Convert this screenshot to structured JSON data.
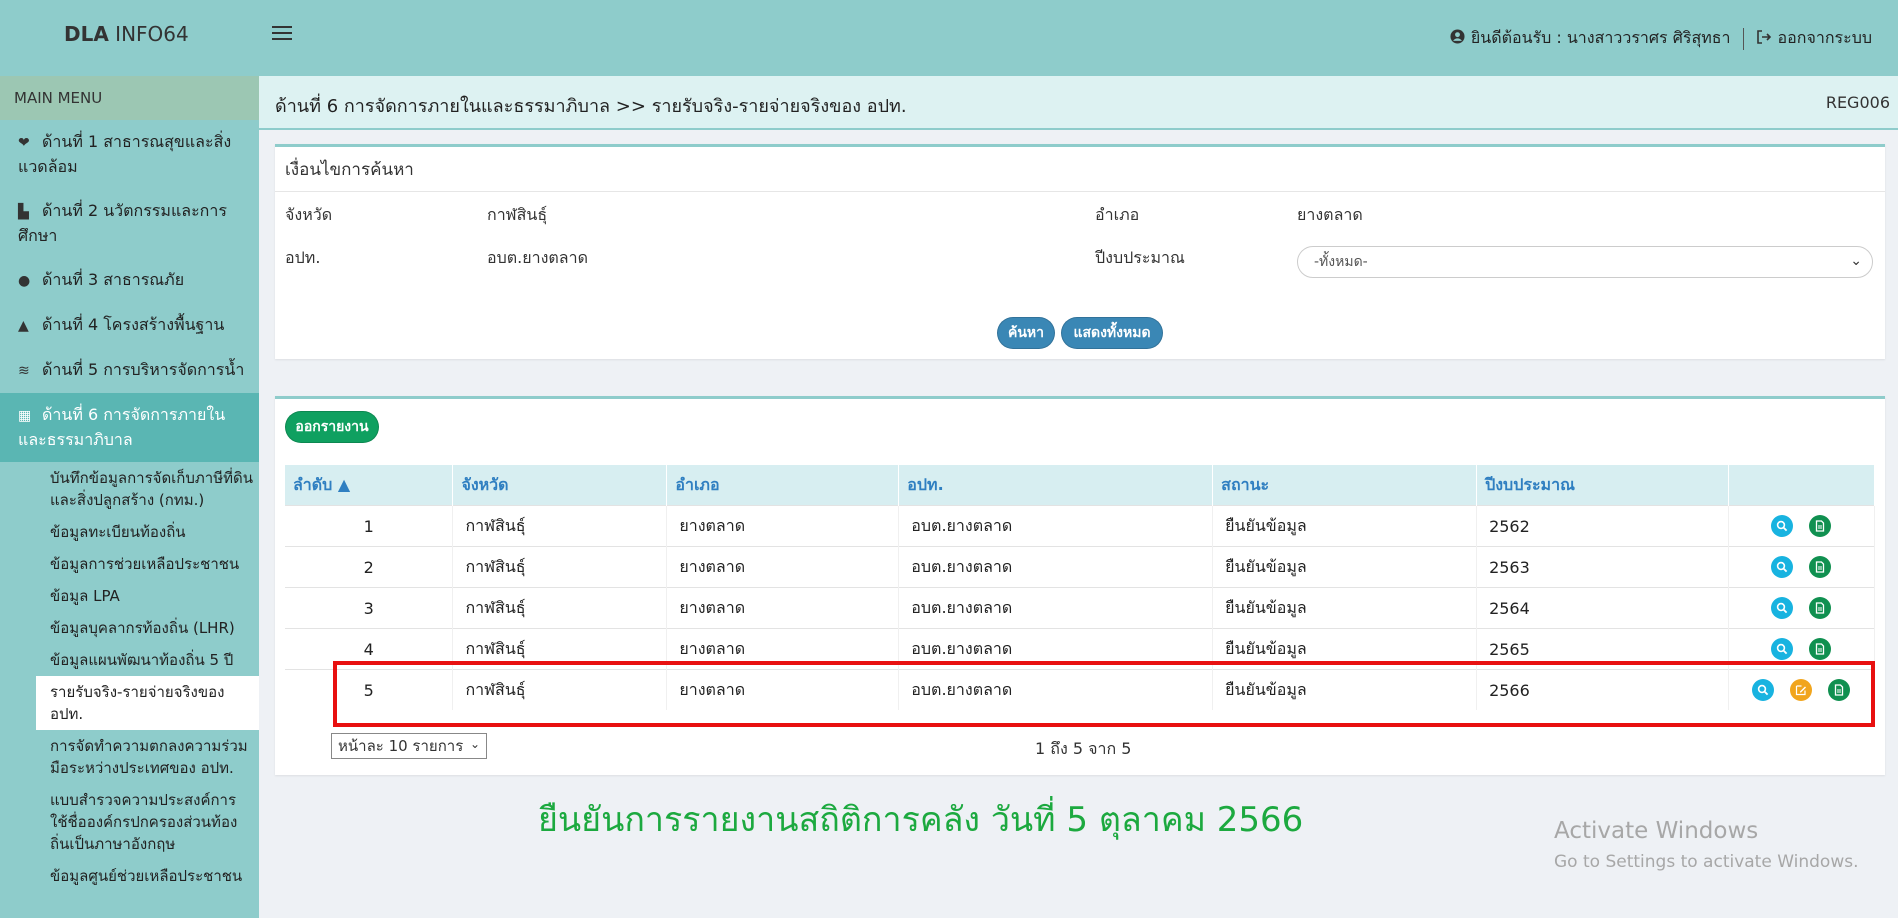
{
  "header": {
    "brand_bold": "DLA",
    "brand_rest": " INFO64",
    "welcome": "ยินดีต้อนรับ : นางสาววราศร ศิริสุทธา",
    "logout": "ออกจากระบบ"
  },
  "sidebar": {
    "menu_title": "MAIN MENU",
    "items": [
      {
        "label": "ด้านที่ 1 สาธารณสุขและสิ่งแวดล้อม",
        "icon": "heartbeat-icon"
      },
      {
        "label": "ด้านที่ 2 นวัตกรรมและการศึกษา",
        "icon": "school-icon"
      },
      {
        "label": "ด้านที่ 3 สาธารณภัย",
        "icon": "user-shield-icon"
      },
      {
        "label": "ด้านที่ 4 โครงสร้างพื้นฐาน",
        "icon": "road-icon"
      },
      {
        "label": "ด้านที่ 5 การบริหารจัดการน้ำ",
        "icon": "water-icon"
      },
      {
        "label": "ด้านที่ 6 การจัดการภายในและธรรมาภิบาล",
        "icon": "building-icon"
      }
    ],
    "subitems": [
      "บันทึกข้อมูลการจัดเก็บภาษีที่ดินและสิ่งปลูกสร้าง (กทม.)",
      "ข้อมูลทะเบียนท้องถิ่น",
      "ข้อมูลการช่วยเหลือประชาชน",
      "ข้อมูล LPA",
      "ข้อมูลบุคลากรท้องถิ่น (LHR)",
      "ข้อมูลแผนพัฒนาท้องถิ่น 5 ปี",
      "รายรับจริง-รายจ่ายจริงของ อปท.",
      "การจัดทำความตกลงความร่วมมือระหว่างประเทศของ อปท.",
      "แบบสำรวจความประสงค์การใช้ชื่อองค์กรปกครองส่วนท้องถิ่นเป็นภาษาอังกฤษ",
      "ข้อมูลศูนย์ช่วยเหลือประชาชน"
    ]
  },
  "breadcrumb": {
    "text": "ด้านที่ 6 การจัดการภายในและธรรมาภิบาล >>  รายรับจริง-รายจ่ายจริงของ อปท.",
    "code": "REG006"
  },
  "search": {
    "title": "เงื่อนไขการค้นหา",
    "province_label": "จังหวัด",
    "province_value": "กาฬสินธุ์",
    "district_label": "อำเภอ",
    "district_value": "ยางตลาด",
    "org_label": "อปท.",
    "org_value": "อบต.ยางตลาด",
    "year_label": "ปีงบประมาณ",
    "year_value": "-ทั้งหมด-",
    "search_btn": "ค้นหา",
    "show_all_btn": "แสดงทั้งหมด"
  },
  "results": {
    "report_btn": "ออกรายงาน",
    "columns": [
      "ลำดับ ▲",
      "จังหวัด",
      "อำเภอ",
      "อปท.",
      "สถานะ",
      "ปีงบประมาณ"
    ],
    "rows": [
      {
        "no": "1",
        "province": "กาฬสินธุ์",
        "district": "ยางตลาด",
        "org": "อบต.ยางตลาด",
        "status": "ยืนยันข้อมูล",
        "year": "2562"
      },
      {
        "no": "2",
        "province": "กาฬสินธุ์",
        "district": "ยางตลาด",
        "org": "อบต.ยางตลาด",
        "status": "ยืนยันข้อมูล",
        "year": "2563"
      },
      {
        "no": "3",
        "province": "กาฬสินธุ์",
        "district": "ยางตลาด",
        "org": "อบต.ยางตลาด",
        "status": "ยืนยันข้อมูล",
        "year": "2564"
      },
      {
        "no": "4",
        "province": "กาฬสินธุ์",
        "district": "ยางตลาด",
        "org": "อบต.ยางตลาด",
        "status": "ยืนยันข้อมูล",
        "year": "2565"
      },
      {
        "no": "5",
        "province": "กาฬสินธุ์",
        "district": "ยางตลาด",
        "org": "อบต.ยางตลาด",
        "status": "ยืนยันข้อมูล",
        "year": "2566"
      }
    ],
    "page_size": "หน้าละ 10 รายการ",
    "page_info": "1 ถึง 5 จาก 5"
  },
  "annotation": {
    "confirm_text": "ยืนยันการรายงานสถิติการคลัง วันที่ 5 ตุลาคม 2566",
    "highlight_color": "#e81010"
  },
  "watermark": {
    "line1": "Activate Windows",
    "line2": "Go to Settings to activate Windows."
  }
}
